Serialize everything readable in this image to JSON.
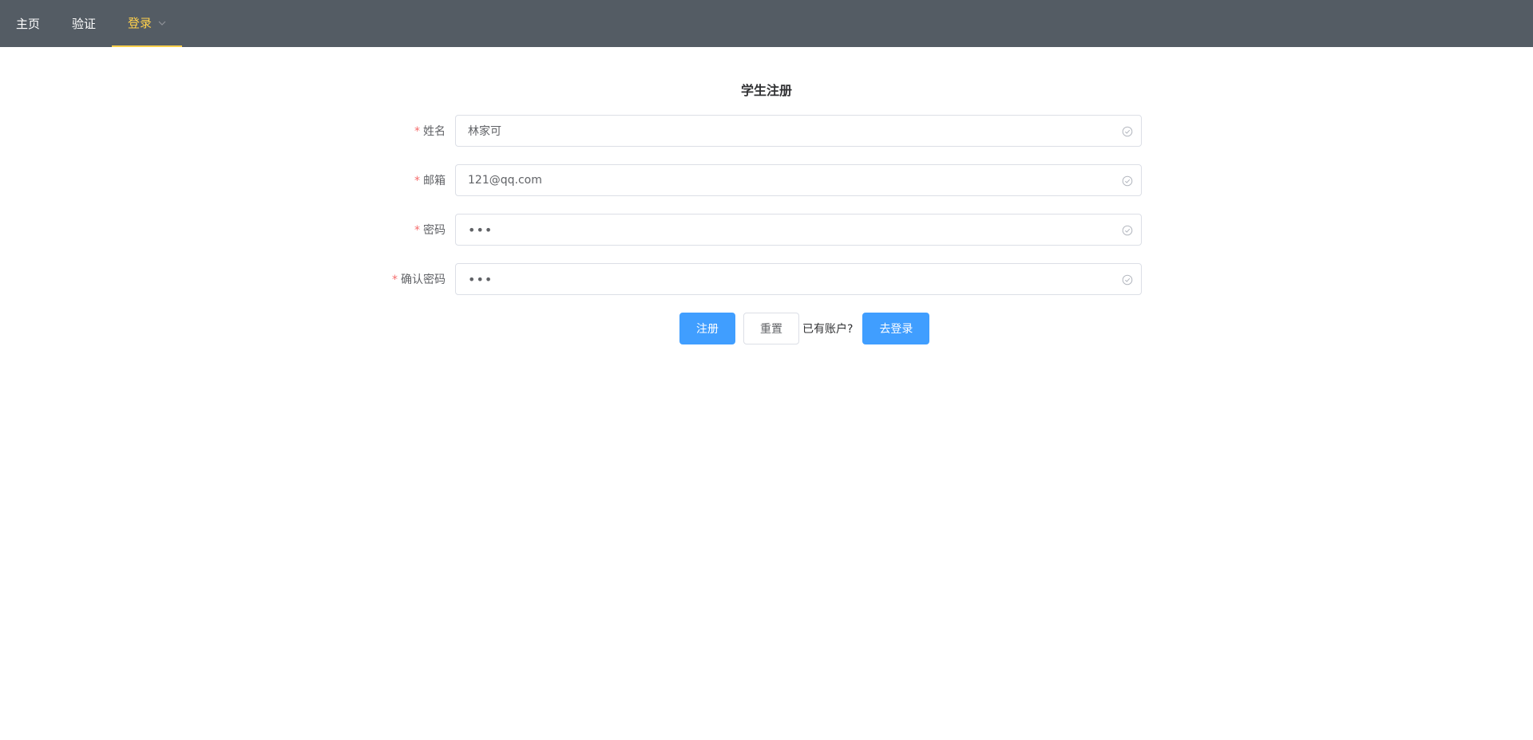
{
  "nav": {
    "items": [
      {
        "label": "主页"
      },
      {
        "label": "验证"
      },
      {
        "label": "登录"
      }
    ],
    "active_color": "#ffd04b",
    "bg_color": "#545c64"
  },
  "form": {
    "title": "学生注册",
    "fields": [
      {
        "label": "姓名",
        "value": "林家可",
        "required": "*"
      },
      {
        "label": "邮箱",
        "value": "121@qq.com",
        "required": "*"
      },
      {
        "label": "密码",
        "value": "•••",
        "required": "*"
      },
      {
        "label": "确认密码",
        "value": "•••",
        "required": "*"
      }
    ]
  },
  "actions": {
    "register_label": "注册",
    "reset_label": "重置",
    "hint_text": "已有账户?",
    "goto_login_label": "去登录",
    "primary_color": "#409eff"
  },
  "icons": {
    "field_status": "circle-check-icon",
    "menu_expand": "chevron-down-icon"
  }
}
